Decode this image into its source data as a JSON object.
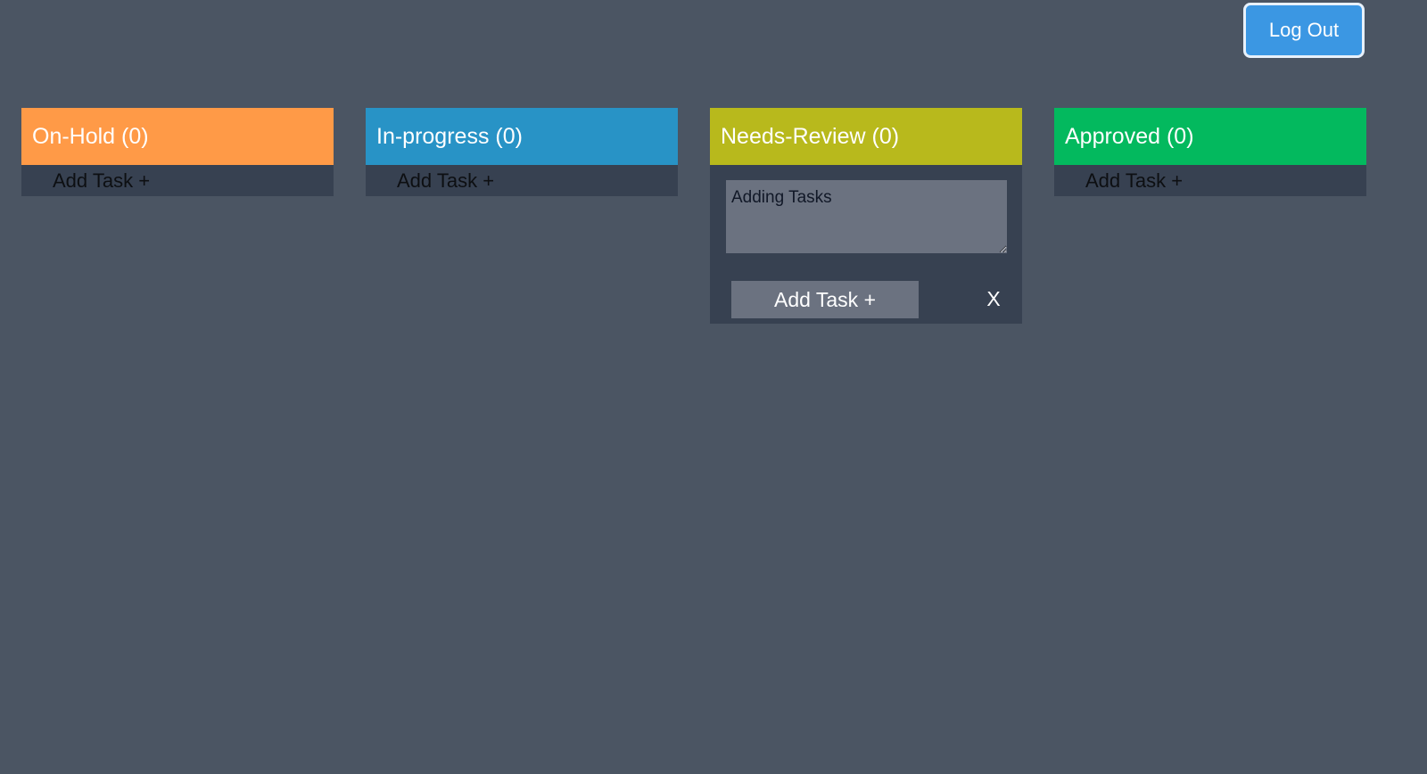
{
  "header": {
    "logout_label": "Log Out"
  },
  "columns": [
    {
      "title": "On-Hold (0)",
      "add_task_label": "Add Task +",
      "color": "#ff9a47"
    },
    {
      "title": "In-progress (0)",
      "add_task_label": "Add Task +",
      "color": "#2893c6"
    },
    {
      "title": "Needs-Review (0)",
      "add_task_label": "Add Task +",
      "color": "#b8b91c",
      "editor": {
        "textarea_value": "Adding Tasks",
        "add_button_label": "Add Task +",
        "close_label": "X"
      }
    },
    {
      "title": "Approved (0)",
      "add_task_label": "Add Task +",
      "color": "#03b95e"
    }
  ],
  "colors": {
    "background": "#4b5563",
    "column_body": "#374151",
    "logout_button": "#3b97e3",
    "input_background": "#6b7280"
  }
}
